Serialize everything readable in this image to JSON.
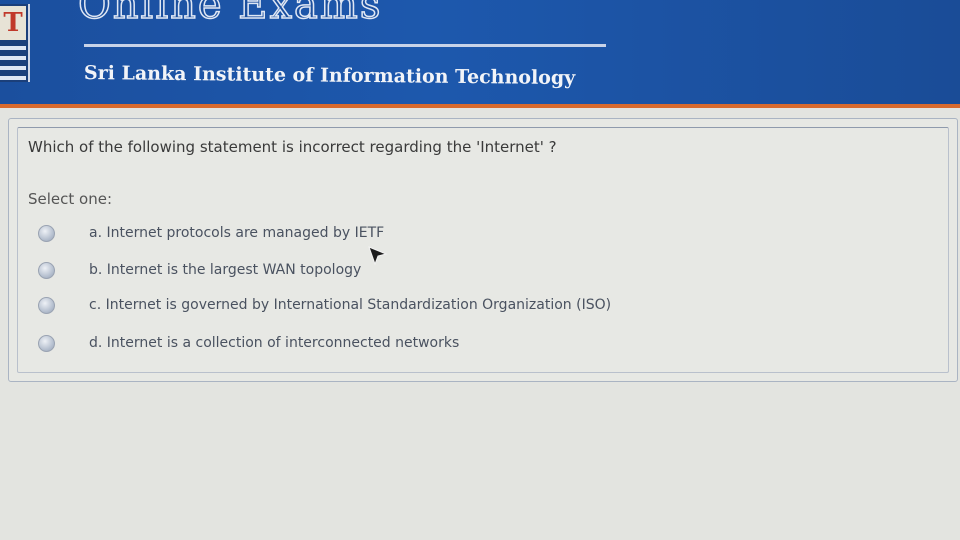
{
  "header": {
    "title": "Online Exams",
    "subtitle": "Sri Lanka Institute of Information Technology",
    "logo_letter": "T"
  },
  "question": {
    "text": "Which of the following statement is incorrect regarding the 'Internet' ?",
    "select_label": "Select one:",
    "options": [
      {
        "label": "a. Internet protocols are managed by IETF",
        "selected": false
      },
      {
        "label": "b. Internet is the largest WAN topology",
        "selected": false
      },
      {
        "label": "c. Internet is governed by International Standardization Organization (ISO)",
        "selected": false
      },
      {
        "label": "d. Internet is a collection of interconnected networks",
        "selected": false
      }
    ]
  },
  "colors": {
    "header_blue": "#1b4f9e",
    "header_accent": "#d86a2e",
    "page_background": "#e3e4e0"
  }
}
